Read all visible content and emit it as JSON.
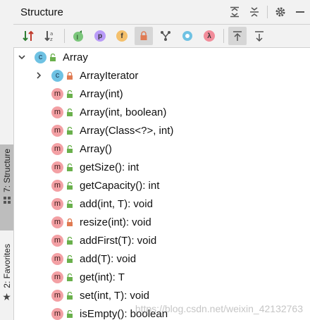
{
  "panel": {
    "title": "Structure"
  },
  "side_tabs": [
    {
      "label": "7: Structure",
      "active": true
    },
    {
      "label": "2: Favorites",
      "active": false
    }
  ],
  "toolbar": {
    "buttons": [
      {
        "icon": "sort-by-visibility-icon"
      },
      {
        "icon": "sort-alphabetically-icon"
      },
      {
        "icon": "show-inherited-icon"
      },
      {
        "icon": "show-properties-icon",
        "letter": "p",
        "color": "#b99bf8"
      },
      {
        "icon": "show-fields-icon",
        "letter": "f",
        "color": "#f4c06c"
      },
      {
        "icon": "show-non-public-icon",
        "selected": true
      },
      {
        "icon": "show-includes-icon"
      },
      {
        "icon": "show-anonymous-classes-icon"
      },
      {
        "icon": "show-lambdas-icon",
        "letter": "λ",
        "color": "#f28c9a"
      },
      {
        "icon": "autoscroll-to-source-icon",
        "selected": true
      },
      {
        "icon": "autoscroll-from-source-icon"
      }
    ]
  },
  "colors": {
    "class_badge": "#6fc2e3",
    "method_badge": "#f3a0a4",
    "public_lock": "#6ab04c",
    "private_lock": "#e07b53"
  },
  "tree": {
    "root": {
      "label": "Array",
      "kind": "c",
      "visibility": "public",
      "expanded": true
    },
    "items": [
      {
        "label": "ArrayIterator",
        "kind": "c",
        "visibility": "private",
        "collapsed": true
      },
      {
        "label": "Array(int)",
        "kind": "m",
        "visibility": "public"
      },
      {
        "label": "Array(int, boolean)",
        "kind": "m",
        "visibility": "public"
      },
      {
        "label": "Array(Class<?>, int)",
        "kind": "m",
        "visibility": "public"
      },
      {
        "label": "Array()",
        "kind": "m",
        "visibility": "public"
      },
      {
        "label": "getSize(): int",
        "kind": "m",
        "visibility": "public"
      },
      {
        "label": "getCapacity(): int",
        "kind": "m",
        "visibility": "public"
      },
      {
        "label": "add(int, T): void",
        "kind": "m",
        "visibility": "public"
      },
      {
        "label": "resize(int): void",
        "kind": "m",
        "visibility": "private"
      },
      {
        "label": "addFirst(T): void",
        "kind": "m",
        "visibility": "public"
      },
      {
        "label": "add(T): void",
        "kind": "m",
        "visibility": "public"
      },
      {
        "label": "get(int): T",
        "kind": "m",
        "visibility": "public"
      },
      {
        "label": "set(int, T): void",
        "kind": "m",
        "visibility": "public"
      },
      {
        "label": "isEmpty(): boolean",
        "kind": "m",
        "visibility": "public"
      }
    ]
  },
  "watermark": "https://blog.csdn.net/weixin_42132763"
}
